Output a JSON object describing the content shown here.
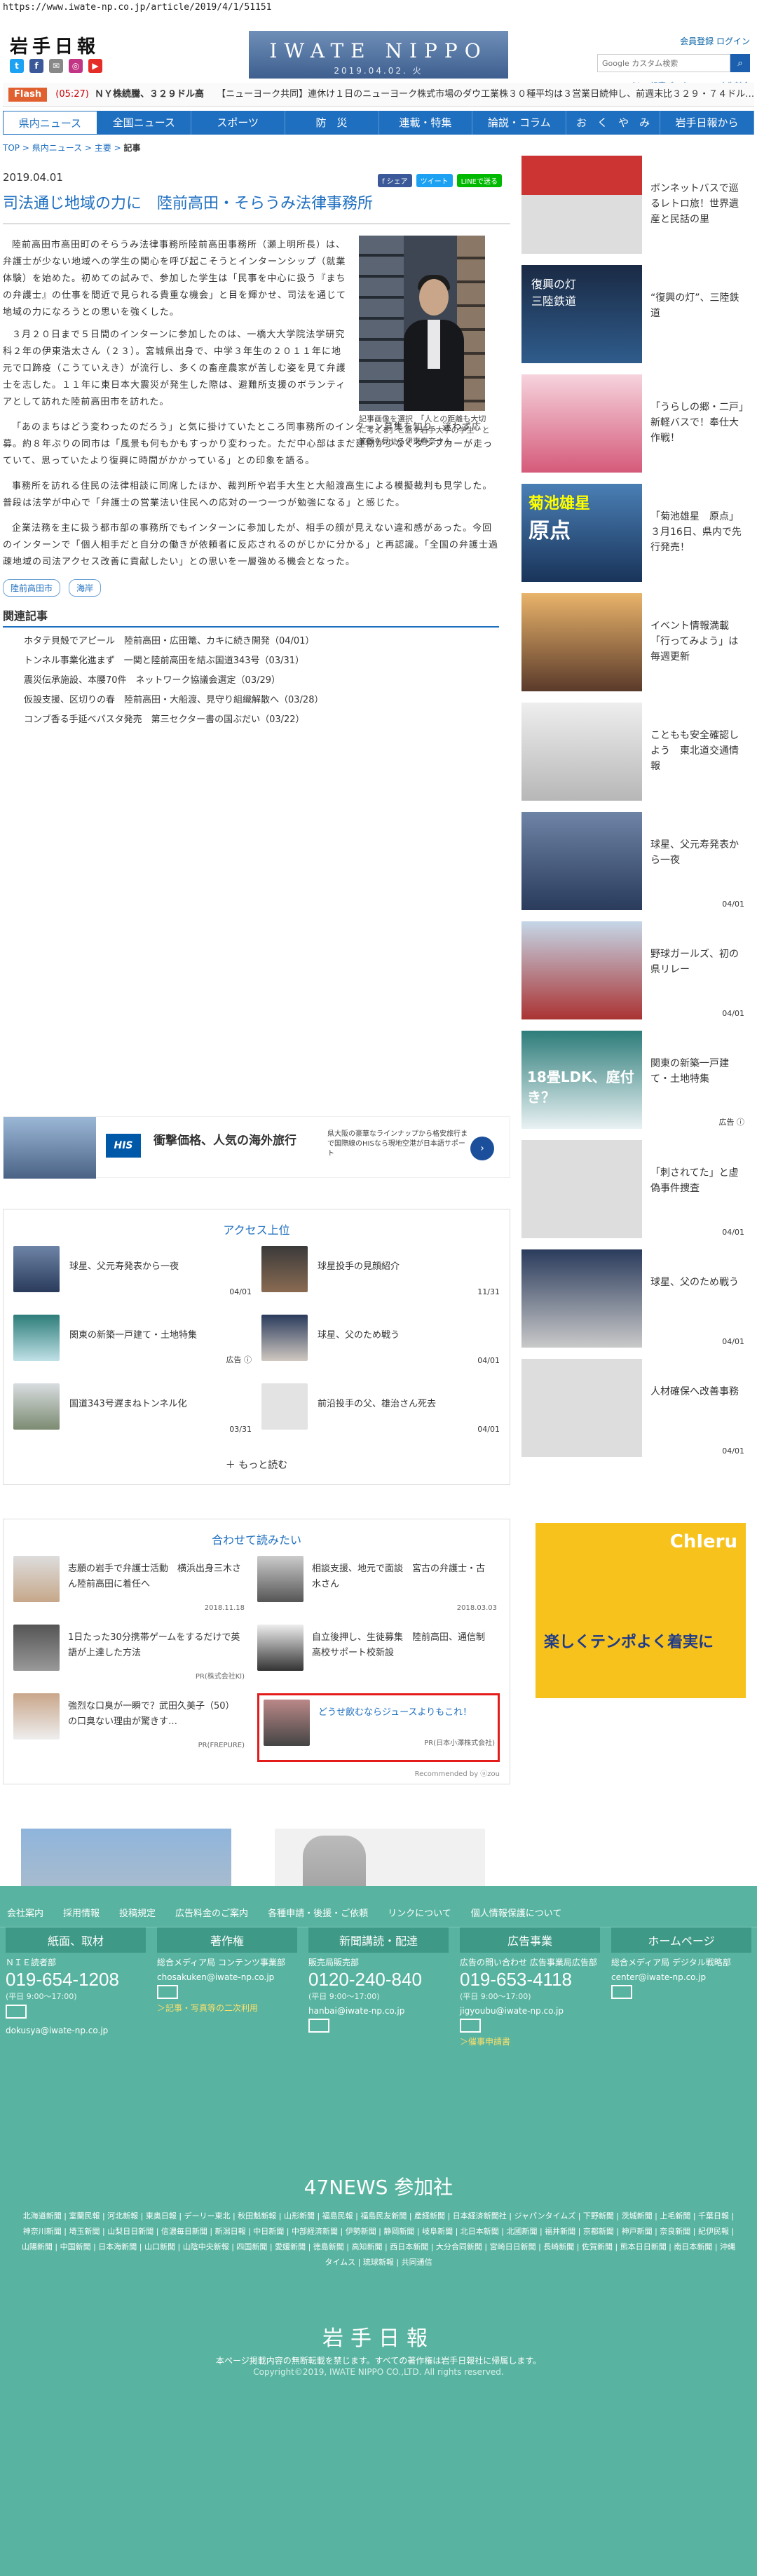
{
  "url": "https://www.iwate-np.co.jp/article/2019/4/1/51151",
  "header": {
    "logo": "岩手日報",
    "banner_brand": "IWATE NIPPO",
    "banner_date": "2019.04.02. 火",
    "links": "会員登録 ログイン",
    "search_placeholder": "Google カスタム検索",
    "subnav": "Webアルバム | 記事データベース | 広告料金"
  },
  "flash": {
    "tag": "Flash",
    "time": "(05:27)",
    "headline": "ＮＹ株続騰、３２９ドル高",
    "text": "【ニューヨーク共同】連休け１日のニューヨーク株式市場のダウ工業株３０種平均は３営業日続伸し、前週末比３２９・７４ドル…"
  },
  "nav": [
    "県内ニュース",
    "全国ニュース",
    "スポーツ",
    "防　災",
    "連載・特集",
    "論説・コラム",
    "お　く　や　み",
    "岩手日報から"
  ],
  "breadcrumb": {
    "top": "TOP",
    "sep": " > ",
    "local": "県内ニュース",
    "main": "主要",
    "current": "記事"
  },
  "article": {
    "date": "2019.04.01",
    "share": [
      "f シェア",
      "ツイート",
      "LINEで送る"
    ],
    "title": "司法通じ地域の力に　陸前高田・そらうみ法律事務所",
    "caption": "記事画像を選択　「人との距離も大切に考える」と話す岩手大学の学生　と笑顔を見せる伊東春奈さん",
    "paras": [
      "陸前高田市高田町のそらうみ法律事務所陸前高田事務所（瀬上明所長）は、弁護士が少ない地域への学生の関心を呼び起こそうとインターンシップ（就業体験）を始めた。初めての試みで、参加した学生は「民事を中心に扱う『まちの弁護士』の仕事を間近で見られる貴重な機会」と目を輝かせ、司法を通じて地域の力になろうとの思いを強くした。",
      "３月２０日まで５日間のインターンに参加したのは、一橋大大学院法学研究科２年の伊東浩太さん（２３）。宮城県出身で、中学３年生の２０１１年に地元で口蹄疫（こうていえき）が流行し、多くの畜産農家が苦しむ姿を見て弁護士を志した。１１年に東日本大震災が発生した際は、避難所支援のボランティアとして訪れた陸前高田市を訪れた。"
    ],
    "paras_wide": [
      "「あのまちはどう変わったのだろう」と気に掛けていたところ同事務所のインターン募集を知り、迷わず応募。約８年ぶりの同市は「風景も何もかもすっかり変わった。ただ中心部はまだ建物が少なくダンプカーが走っていて、思っていたより復興に時間がかかっている」との印象を語る。",
      "事務所を訪れる住民の法律相談に同席したほか、裁判所や岩手大生と大船渡高生による模擬裁判も見学した。普段は法学が中心で「弁護士の営業法い住民への応対の一つ一つが勉強になる」と感じた。",
      "企業法務を主に扱う都市部の事務所でもインターンに参加したが、相手の顔が見えない違和感があった。今回のインターンで「個人相手だと自分の働きが依頼者に反応されるのがじかに分かる」と再認識。「全国の弁護士過疎地域の司法アクセス改善に貢献したい」との思いを一層強める機会となった。"
    ],
    "tags": [
      "陸前高田市",
      "海岸"
    ]
  },
  "related": {
    "heading": "関連記事",
    "items": [
      "ホタテ貝殻でアピール　陸前高田・広田篭、カキに続き開発（04/01）",
      "トンネル事業化進まず　一関と陸前高田を結ぶ国道343号（03/31）",
      "震災伝承施設、本腰70件　ネットワーク協議会選定（03/29）",
      "仮設支援、区切りの春　陸前高田・大船渡、見守り組織解散へ（03/28）",
      "コンブ香る手延べパスタ発売　第三セクター書の国ぶだい（03/22）"
    ]
  },
  "ad": {
    "brand": "HIS",
    "title": "衝撃価格、人気の海外旅行",
    "text": "県大阪の豪華なラインナップから格安旅行まで国際線のHISなら現地空港が日本語サポート"
  },
  "access": {
    "heading": "アクセス上位",
    "items": [
      {
        "text": "球星、父元寿発表から一夜",
        "date": "04/01"
      },
      {
        "text": "球星投手の見顔紹介",
        "date": "11/31"
      },
      {
        "text": "関東の新築一戸建て・土地特集",
        "date": "広告 ⓘ"
      },
      {
        "text": "球星、父のため戦う",
        "date": "04/01"
      },
      {
        "text": "国道343号遅まねトンネル化",
        "date": "03/31"
      },
      {
        "text": "前沿投手の父、雄治さん死去",
        "date": "04/01"
      }
    ],
    "more": "もっと読む"
  },
  "recommend": {
    "heading": "合わせて読みたい",
    "items": [
      {
        "text": "志願の岩手で弁護士活動　横浜出身三木さん陸前高田に着任へ",
        "src": "2018.11.18"
      },
      {
        "text": "相談支援、地元で面談　宮古の弁護士・古水さん",
        "src": "2018.03.03"
      },
      {
        "text": "1日たった30分携帯ゲームをするだけで英語が上達した方法",
        "src": "PR(株式会社Kl)"
      },
      {
        "text": "自立後押し、生徒募集　陸前高田、通信制高校サポート校新設",
        "src": ""
      },
      {
        "text": "強烈な口臭が一瞬で？武田久美子（50）の口臭ない理由が驚きす…",
        "src": "PR(FREPURE)"
      },
      {
        "text": "どうせ飲むならジュースよりもこれ！",
        "src": "PR(日本小澤株式会社)"
      }
    ],
    "by": "Recommended by ⓤzou"
  },
  "sidebar": [
    {
      "text": "ボンネットバスで巡るレトロ旅！世界遺産と民話の里",
      "date": ""
    },
    {
      "text": "“復興の灯”、三陸鉄道",
      "date": ""
    },
    {
      "text": "「うらしの郷・二戸」新軽バスで！奉仕大作戦！",
      "date": ""
    },
    {
      "text": "「菊池雄星　原点」３月16日、県内で先行発売！",
      "date": ""
    },
    {
      "text": "イベント情報満載「行ってみよう」は毎週更新",
      "date": ""
    },
    {
      "text": "こともも安全確認しよう　東北道交通情報",
      "date": ""
    },
    {
      "text": "球星、父元寿発表から一夜",
      "date": "04/01"
    },
    {
      "text": "野球ガールズ、初の県リレー",
      "date": "04/01"
    },
    {
      "text": "関東の新築一戸建て・土地特集",
      "date": "広告 ⓘ"
    },
    {
      "text": "「刺されてた」と虚偽事件捜査",
      "date": "04/01"
    },
    {
      "text": "球星、父のため戦う",
      "date": "04/01"
    },
    {
      "text": "人材確保へ改善事務",
      "date": "04/01"
    }
  ],
  "sidebar_img_labels": {
    "train_caption": "復興の灯",
    "train_sub": "三陸鉄道",
    "yusei_name": "菊池雄星",
    "yusei_sub": "原点",
    "house_text": "18畳LDK、庭付き？",
    "chieru": "ChIeru",
    "chieru_text": "楽しくテンポよく着実に"
  },
  "footer": {
    "links": [
      "会社案内",
      "採用情報",
      "投稿規定",
      "広告料金のご案内",
      "各種申請・後援・ご依頼",
      "リンクについて",
      "個人情報保護について"
    ],
    "cols": [
      {
        "h": "紙面、取材",
        "s": "ＮＩＥ読者部",
        "num": "019-654-1208",
        "small": "(平日 9:00～17:00)",
        "mail": "dokusya@iwate-np.co.jp",
        "lnk": ""
      },
      {
        "h": "著作権",
        "s": "総合メディア局 コンテンツ事業部",
        "num": "",
        "small": "",
        "mail": "chosakuken@iwate-np.co.jp",
        "lnk": "＞記事・写真等の二次利用"
      },
      {
        "h": "新聞講読・配達",
        "s": "販売局販売部",
        "num": "0120-240-840",
        "small": "(平日 9:00～17:00)",
        "mail": "hanbai@iwate-np.co.jp",
        "lnk": ""
      },
      {
        "h": "広告事業",
        "s": "広告の問い合わせ 広告事業局広告部",
        "num": "019-653-4118",
        "small": "(平日 9:00～17:00)",
        "mail": "jigyoubu@iwate-np.co.jp",
        "lnk": "＞催事申請書"
      },
      {
        "h": "ホームページ",
        "s": "総合メディア局 デジタル戦略部",
        "num": "",
        "small": "",
        "mail": "center@iwate-np.co.jp",
        "lnk": ""
      }
    ],
    "n47": "47NEWS 参加社",
    "papers": "北海道新聞 | 室蘭民報 | 河北新報 | 東奥日報 | デーリー東北 | 秋田魁新報 | 山形新聞 | 福島民報 | 福島民友新聞 | 産経新聞 | 日本経済新聞社 | ジャパンタイムズ | 下野新聞 | 茨城新聞 | 上毛新聞 | 千葉日報 | 神奈川新聞 | 埼玉新聞 | 山梨日日新聞 | 信濃毎日新聞 | 新潟日報 | 中日新聞 | 中部経済新聞 | 伊勢新聞 | 静岡新聞 | 岐阜新聞 | 北日本新聞 | 北國新聞 | 福井新聞 | 京都新聞 | 神戸新聞 | 奈良新聞 | 紀伊民報 | 山陽新聞 | 中国新聞 | 日本海新聞 | 山口新聞 | 山陰中央新報 | 四国新聞 | 愛媛新聞 | 徳島新聞 | 高知新聞 | 西日本新聞 | 大分合同新聞 | 宮崎日日新聞 | 長崎新聞 | 佐賀新聞 | 熊本日日新聞 | 南日本新聞 | 沖縄タイムス | 琉球新報 | 共同通信",
    "logo": "岩手日報",
    "note": "本ページ掲載内容の無断転載を禁じます。すべての著作権は岩手日報社に帰属します。",
    "copy": "Copyright©2019, IWATE NIPPO CO.,LTD. All rights reserved."
  }
}
